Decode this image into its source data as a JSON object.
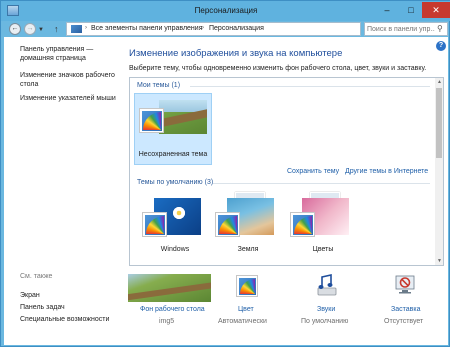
{
  "window": {
    "title": "Персонализация"
  },
  "addressbar": {
    "breadcrumb": [
      "Все элементы панели управления",
      "Персонализация"
    ],
    "search_placeholder": "Поиск в панели упр..."
  },
  "sidebar": {
    "links": [
      "Панель управления —",
      "домашняя страница",
      "Изменение значков рабочего",
      "стола",
      "Изменение указателей мыши"
    ],
    "see_also": "См. также",
    "see_also_links": [
      "Экран",
      "Панель задач",
      "Специальные возможности"
    ]
  },
  "main": {
    "title": "Изменение изображения и звука на компьютере",
    "description": "Выберите тему, чтобы одновременно изменить фон рабочего стола, цвет, звуки и заставку."
  },
  "themes": {
    "my_themes_label": "Мои темы (1)",
    "unsaved_theme": "Несохраненная тема",
    "save_theme": "Сохранить тему",
    "more_themes": "Другие темы в Интернете",
    "default_themes_label": "Темы по умолчанию (3)",
    "default_themes": [
      "Windows",
      "Земля",
      "Цветы"
    ]
  },
  "bottom": {
    "items": [
      {
        "label": "Фон рабочего стола",
        "sub": "img5"
      },
      {
        "label": "Цвет",
        "sub": "Автоматически"
      },
      {
        "label": "Звуки",
        "sub": "По умолчанию"
      },
      {
        "label": "Заставка",
        "sub": "Отсутствует"
      }
    ]
  },
  "colors": {
    "accent": "#1f5fa8",
    "selection": "#cce8ff",
    "titlebar": "#5fb2df"
  }
}
